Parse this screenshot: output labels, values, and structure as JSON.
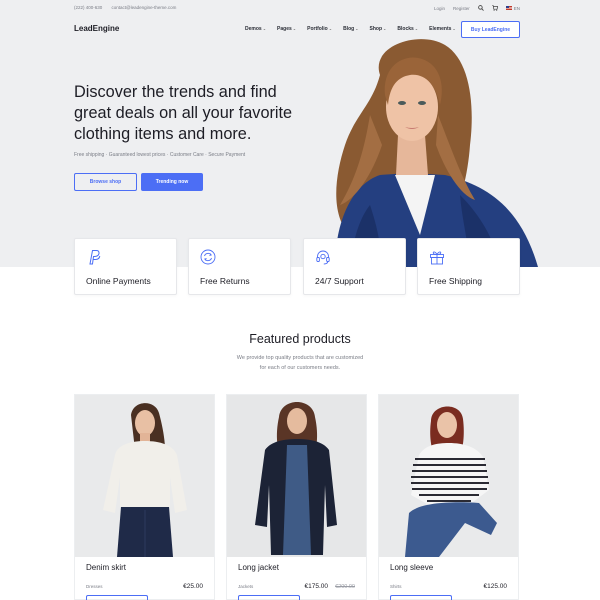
{
  "topbar": {
    "phone": "(222) 400-630",
    "email": "contact@leadengine-theme.com",
    "login": "Login",
    "register": "Register",
    "language": "EN"
  },
  "header": {
    "logo": "LeadEngine",
    "nav": [
      {
        "label": "Demos"
      },
      {
        "label": "Pages"
      },
      {
        "label": "Portfolio"
      },
      {
        "label": "Blog"
      },
      {
        "label": "Shop"
      },
      {
        "label": "Blocks"
      },
      {
        "label": "Elements"
      }
    ],
    "cta": "Buy LeadEngine"
  },
  "hero": {
    "title": "Discover the trends and find great deals on all your favorite clothing items and more.",
    "subtitle": "Free shipping · Guaranteed lowest prices · Customer Care · Secure Payment",
    "btn_browse": "Browse shop",
    "btn_trending": "Trending now"
  },
  "features": [
    {
      "label": "Online Payments",
      "icon": "paypal-icon"
    },
    {
      "label": "Free Returns",
      "icon": "refresh-icon"
    },
    {
      "label": "24/7 Support",
      "icon": "headset-icon"
    },
    {
      "label": "Free Shipping",
      "icon": "gift-icon"
    }
  ],
  "featured": {
    "title": "Featured products",
    "subtitle_line1": "We provide top quality products that are customized",
    "subtitle_line2": "for each of our customers needs."
  },
  "products": [
    {
      "name": "Denim skirt",
      "category": "Dresses",
      "price": "€25.00",
      "old_price": ""
    },
    {
      "name": "Long jacket",
      "category": "Jackets",
      "price": "€175.00",
      "old_price": "€200.00"
    },
    {
      "name": "Long sleeve",
      "category": "Shirts",
      "price": "€125.00",
      "old_price": ""
    }
  ],
  "colors": {
    "accent": "#4c6ef5",
    "hero_bg": "#eeeff1",
    "text": "#1d1d25",
    "muted": "#7a7d86"
  }
}
